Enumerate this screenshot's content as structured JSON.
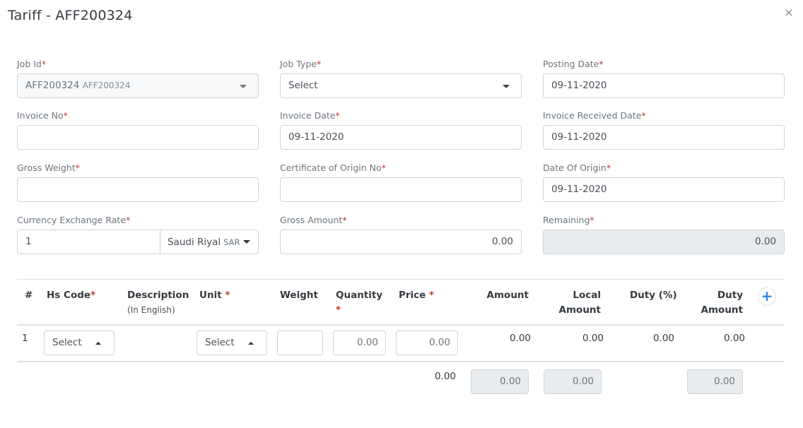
{
  "modal": {
    "title": "Tariff - AFF200324",
    "close_glyph": "×"
  },
  "form": {
    "job_id": {
      "label": "Job Id",
      "value": "AFF200324",
      "sub_value": "AFF200324"
    },
    "job_type": {
      "label": "Job Type",
      "value": "Select"
    },
    "posting_date": {
      "label": "Posting Date",
      "value": "09-11-2020"
    },
    "invoice_no": {
      "label": "Invoice No",
      "value": ""
    },
    "invoice_date": {
      "label": "Invoice Date",
      "value": "09-11-2020"
    },
    "invoice_received_date": {
      "label": "Invoice Received Date",
      "value": "09-11-2020"
    },
    "gross_weight": {
      "label": "Gross Weight",
      "value": ""
    },
    "certificate_of_origin_no": {
      "label": "Certificate of Origin No",
      "value": ""
    },
    "date_of_origin": {
      "label": "Date Of Origin",
      "value": "09-11-2020"
    },
    "currency_exchange_rate": {
      "label": "Currency Exchange Rate",
      "value": "1",
      "currency_name": "Saudi Riyal",
      "currency_code": "SAR"
    },
    "gross_amount": {
      "label": "Gross Amount",
      "value": "0.00"
    },
    "remaining": {
      "label": "Remaining",
      "value": "0.00"
    },
    "required_mark": "*"
  },
  "table": {
    "headers": {
      "index": "#",
      "hs_code": "Hs Code",
      "description": "Description",
      "description_sub": "(In English)",
      "unit": "Unit ",
      "weight": "Weight",
      "quantity": "Quantity",
      "price": "Price ",
      "amount": "Amount",
      "local_amount_1": "Local",
      "local_amount_2": "Amount",
      "duty_percent": "Duty (%)",
      "duty_amount_1": "Duty",
      "duty_amount_2": "Amount"
    },
    "add_button_glyph": "+",
    "rows": [
      {
        "index": "1",
        "hs_code": "Select",
        "unit": "Select",
        "weight": "",
        "quantity": "0.00",
        "price": "0.00",
        "amount": "0.00",
        "local_amount": "0.00",
        "duty_percent": "0.00",
        "duty_amount": "0.00"
      }
    ],
    "totals": {
      "price_total": "0.00",
      "amount_total": "0.00",
      "local_amount_total": "0.00",
      "duty_amount_total": "0.00"
    }
  }
}
